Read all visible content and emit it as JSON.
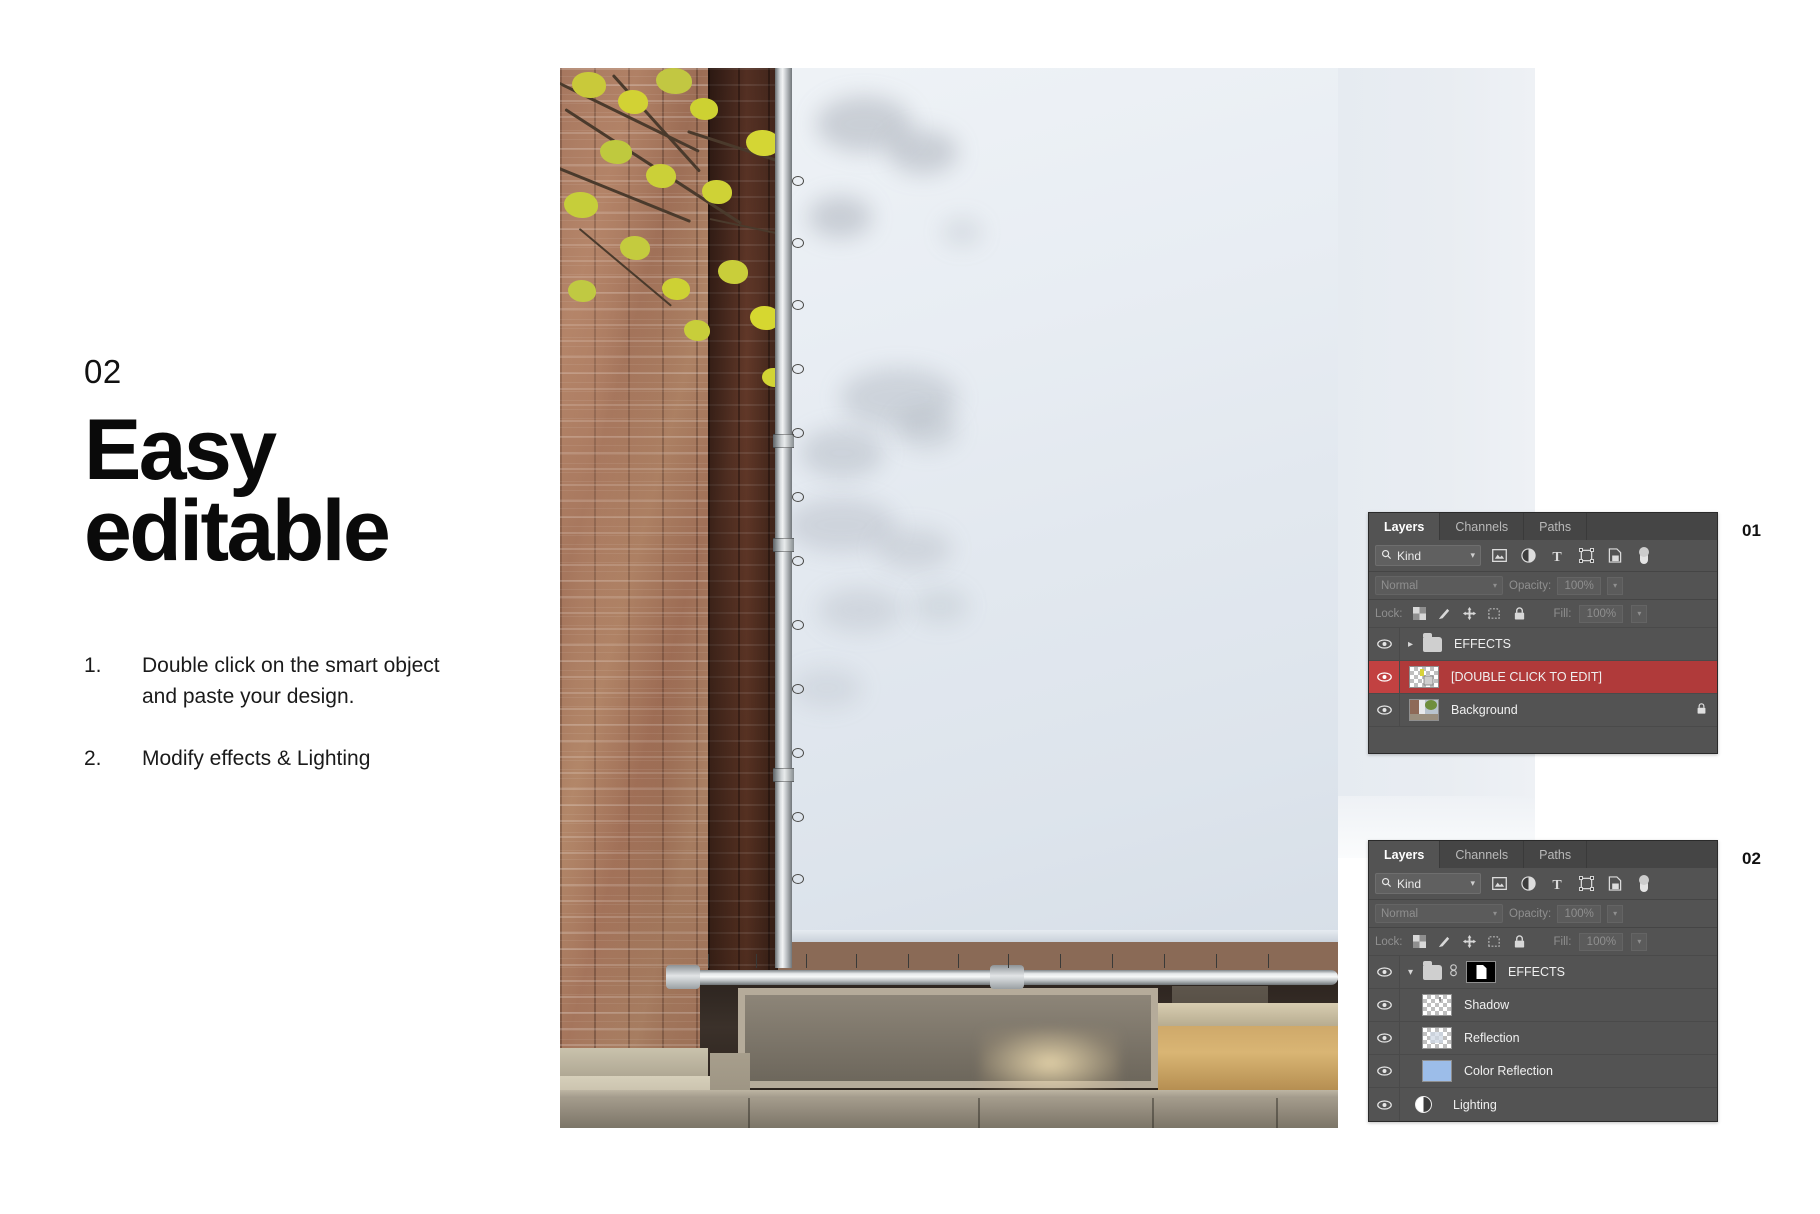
{
  "left": {
    "step_number": "02",
    "headline_line1": "Easy",
    "headline_line2": "editable",
    "instructions": [
      {
        "index": "1.",
        "text": "Double click on the smart object and paste your design."
      },
      {
        "index": "2.",
        "text": "Modify effects & Lighting"
      }
    ]
  },
  "panels": [
    {
      "badge": "01",
      "tabs": [
        {
          "label": "Layers",
          "active": true
        },
        {
          "label": "Channels",
          "active": false
        },
        {
          "label": "Paths",
          "active": false
        }
      ],
      "filter": {
        "kind_label": "Kind",
        "search_icon": "search-icon",
        "chevron": "⌄",
        "icons": [
          "pixel-layer-filter-icon",
          "adjustment-layer-filter-icon",
          "type-layer-filter-icon",
          "shape-layer-filter-icon",
          "smart-object-filter-icon",
          "filter-toggle-icon"
        ]
      },
      "blend": {
        "mode": "Normal",
        "opacity_label": "Opacity:",
        "opacity_value": "100%"
      },
      "lock": {
        "label": "Lock:",
        "icons": [
          "lock-transparent-pixels-icon",
          "lock-image-pixels-icon",
          "lock-position-icon",
          "lock-artboard-nesting-icon",
          "lock-all-icon"
        ],
        "fill_label": "Fill:",
        "fill_value": "100%"
      },
      "layers": [
        {
          "name": "EFFECTS",
          "type": "group",
          "visible": true,
          "selected": false,
          "expanded": false,
          "locked": false,
          "thumb": "folder"
        },
        {
          "name": "[DOUBLE CLICK TO EDIT]",
          "type": "smart-object",
          "visible": true,
          "selected": true,
          "locked": false,
          "thumb": "checker"
        },
        {
          "name": "Background",
          "type": "image",
          "visible": true,
          "selected": false,
          "locked": true,
          "thumb": "photo"
        }
      ]
    },
    {
      "badge": "02",
      "tabs": [
        {
          "label": "Layers",
          "active": true
        },
        {
          "label": "Channels",
          "active": false
        },
        {
          "label": "Paths",
          "active": false
        }
      ],
      "filter": {
        "kind_label": "Kind",
        "search_icon": "search-icon",
        "chevron": "⌄",
        "icons": [
          "pixel-layer-filter-icon",
          "adjustment-layer-filter-icon",
          "type-layer-filter-icon",
          "shape-layer-filter-icon",
          "smart-object-filter-icon",
          "filter-toggle-icon"
        ]
      },
      "blend": {
        "mode": "Normal",
        "opacity_label": "Opacity:",
        "opacity_value": "100%"
      },
      "lock": {
        "label": "Lock:",
        "icons": [
          "lock-transparent-pixels-icon",
          "lock-image-pixels-icon",
          "lock-position-icon",
          "lock-artboard-nesting-icon",
          "lock-all-icon"
        ],
        "fill_label": "Fill:",
        "fill_value": "100%"
      },
      "layers": [
        {
          "name": "EFFECTS",
          "type": "group",
          "visible": true,
          "selected": false,
          "expanded": true,
          "locked": false,
          "thumb": "folder-mask"
        },
        {
          "name": "Shadow",
          "type": "pixel",
          "visible": true,
          "selected": false,
          "locked": false,
          "thumb": "checker"
        },
        {
          "name": "Reflection",
          "type": "pixel",
          "visible": true,
          "selected": false,
          "locked": false,
          "thumb": "checker"
        },
        {
          "name": "Color Reflection",
          "type": "pixel",
          "visible": true,
          "selected": false,
          "locked": false,
          "thumb": "color",
          "thumb_color": "#9cbde9"
        },
        {
          "name": "Lighting",
          "type": "adjustment",
          "visible": true,
          "selected": false,
          "locked": false,
          "thumb": "adjustment"
        }
      ]
    }
  ],
  "colors": {
    "panel_bg": "#535353",
    "panel_header": "#454545",
    "selected_layer": "#b03a3a",
    "color_reflection_swatch": "#9cbde9",
    "banner_white": "#e6ebf1",
    "brick": "#a0715a",
    "blossom_yellow": "#d7d21f"
  },
  "photo": {
    "description": "brick-building-facade-with-blank-white-banner-mockup",
    "alt": "Brick wall facade with blossoming tree branches and a large blank white banner mounted on a rail"
  }
}
